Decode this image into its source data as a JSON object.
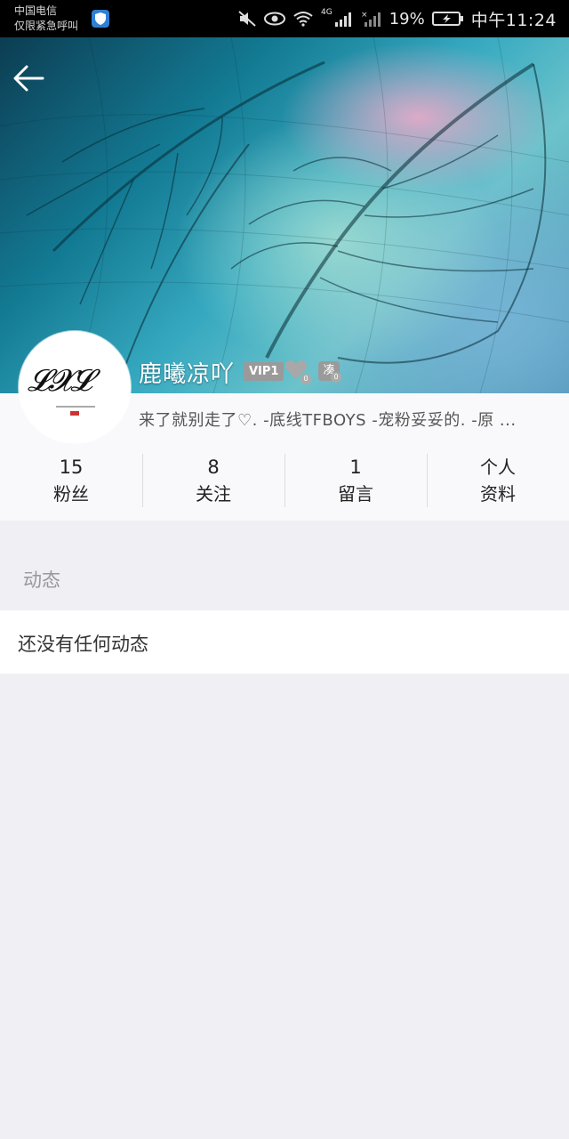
{
  "status_bar": {
    "carrier_line1": "中国电信",
    "carrier_line2": "仅限紧急呼叫",
    "network": "4G",
    "battery_percent": "19%",
    "time": "中午11:24"
  },
  "profile": {
    "nickname": "鹿曦凉吖",
    "vip_label": "VIP1",
    "heart_count": "0",
    "fire_label": "凑",
    "fire_count": "0",
    "signature": "来了就别走了♡. -底线TFBOYS -宠粉妥妥的. -原 ..."
  },
  "stats": [
    {
      "value": "15",
      "label": "粉丝"
    },
    {
      "value": "8",
      "label": "关注"
    },
    {
      "value": "1",
      "label": "留言"
    },
    {
      "line1": "个人",
      "line2": "资料"
    }
  ],
  "feed": {
    "section_title": "动态",
    "empty_text": "还没有任何动态"
  },
  "colors": {
    "accent_vip": "#9a9a9a",
    "page_bg": "#efeff4"
  }
}
